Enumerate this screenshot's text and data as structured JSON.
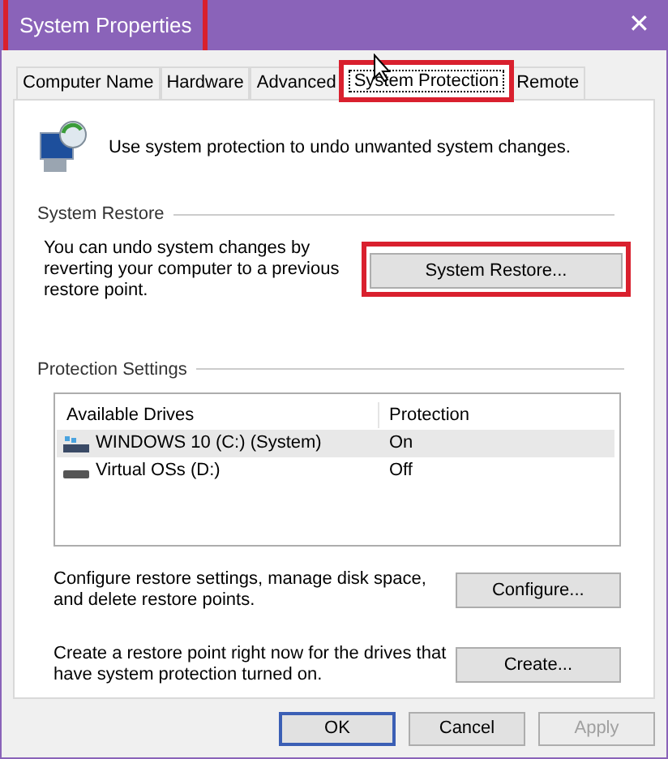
{
  "window": {
    "title": "System Properties",
    "title_highlighted": true,
    "close": "✕"
  },
  "tabs": [
    {
      "label": "Computer Name",
      "selected": false,
      "highlighted": false
    },
    {
      "label": "Hardware",
      "selected": false,
      "highlighted": false
    },
    {
      "label": "Advanced",
      "selected": false,
      "highlighted": false
    },
    {
      "label": "System Protection",
      "selected": true,
      "highlighted": true
    },
    {
      "label": "Remote",
      "selected": false,
      "highlighted": false
    }
  ],
  "intro": "Use system protection to undo unwanted system changes.",
  "system_restore": {
    "heading": "System Restore",
    "text": "You can undo system changes by reverting your computer to a previous restore point.",
    "button": {
      "label": "System Restore...",
      "highlighted": true
    }
  },
  "protection_settings": {
    "heading": "Protection Settings",
    "columns": [
      "Available Drives",
      "Protection"
    ],
    "rows": [
      {
        "drive": "WINDOWS 10 (C:) (System)",
        "protection": "On",
        "selected": true,
        "kind": "system"
      },
      {
        "drive": "Virtual OSs (D:)",
        "protection": "Off",
        "selected": false,
        "kind": "disk"
      }
    ],
    "actions": [
      {
        "text": "Configure restore settings, manage disk space, and delete restore points.",
        "button": "Configure..."
      },
      {
        "text": "Create a restore point right now for the drives that have system protection turned on.",
        "button": "Create..."
      }
    ]
  },
  "buttons": [
    {
      "label": "OK",
      "disabled": false,
      "default": true
    },
    {
      "label": "Cancel",
      "disabled": false,
      "default": false
    },
    {
      "label": "Apply",
      "disabled": true,
      "default": false
    }
  ]
}
